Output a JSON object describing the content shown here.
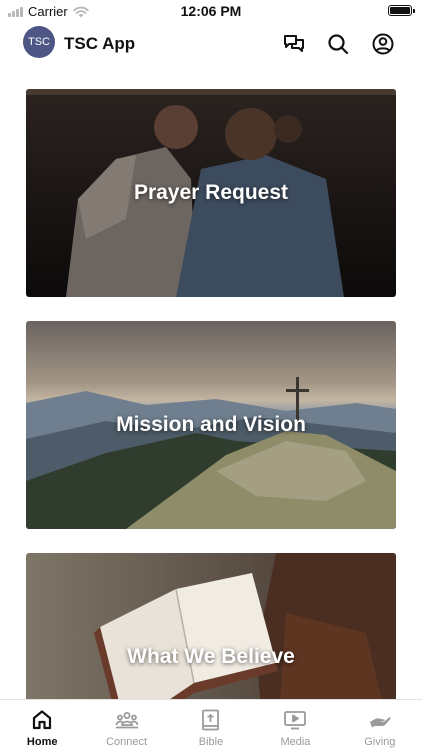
{
  "status_bar": {
    "carrier": "Carrier",
    "time": "12:06 PM"
  },
  "header": {
    "avatar_text": "TSC",
    "title": "TSC App"
  },
  "cards": [
    {
      "title": "Prayer Request"
    },
    {
      "title": "Mission and Vision"
    },
    {
      "title": "What We Believe"
    }
  ],
  "tabs": [
    {
      "label": "Home",
      "icon": "home-icon",
      "active": true
    },
    {
      "label": "Connect",
      "icon": "group-icon",
      "active": false
    },
    {
      "label": "Bible",
      "icon": "bible-icon",
      "active": false
    },
    {
      "label": "Media",
      "icon": "play-icon",
      "active": false
    },
    {
      "label": "Giving",
      "icon": "giving-hand-icon",
      "active": false
    }
  ],
  "colors": {
    "accent": "#111111",
    "inactive": "#9a9a9a",
    "avatar_bg": "#4e5686"
  }
}
